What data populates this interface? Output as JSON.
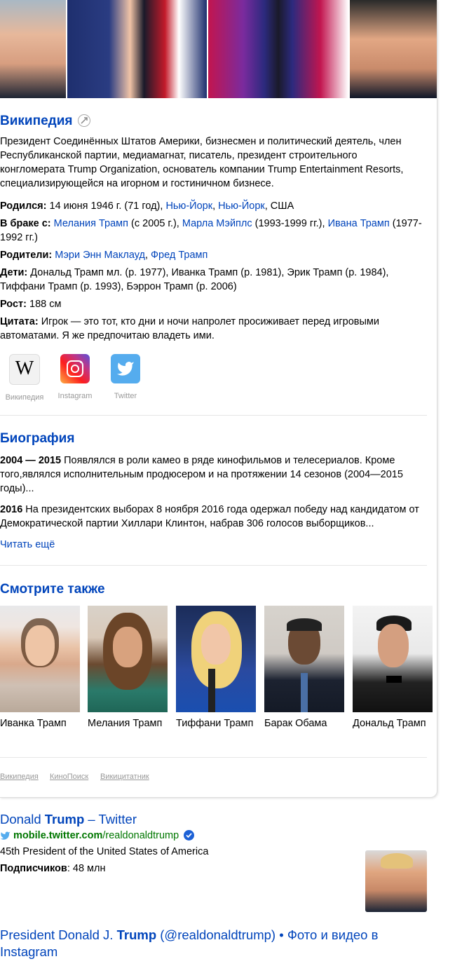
{
  "wiki": {
    "title": "Википедия",
    "description": "Президент Соединённых Штатов Америки, бизнесмен и политический деятель, член Республиканской партии, медиамагнат, писатель, президент строительного конгломерата Trump Organization, основатель компании Trump Entertainment Resorts, специализирующейся на игорном и гостиничном бизнесе.",
    "born": {
      "label": "Родился:",
      "value": "14 июня 1946 г. (71 год),",
      "link1": "Нью-Йорк",
      "sep": ",",
      "link2": "Нью-Йорк",
      "rest": ", США"
    },
    "married": {
      "label": "В браке с:",
      "link1": "Мелания Трамп",
      "t1": "(с 2005 г.),",
      "link2": "Марла Мэйплс",
      "t2": "(1993-1999 гг.),",
      "link3": "Ивана Трамп",
      "t3": "(1977-1992 гг.)"
    },
    "parents": {
      "label": "Родители:",
      "link1": "Мэри Энн Маклауд",
      "sep": ",",
      "link2": "Фред Трамп"
    },
    "children": {
      "label": "Дети:",
      "value": "Дональд Трамп мл. (р. 1977), Иванка Трамп (р. 1981), Эрик Трамп (р. 1984), Тиффани Трамп (р. 1993), Бэррон Трамп (р. 2006)"
    },
    "height": {
      "label": "Рост:",
      "value": "188 см"
    },
    "quote": {
      "label": "Цитата:",
      "value": "Игрок — это тот, кто дни и ночи напролет просиживает перед игровыми автоматами. Я же предпочитаю владеть ими."
    }
  },
  "socials": [
    {
      "label": "Википедия",
      "icon": "wikipedia-icon"
    },
    {
      "label": "Instagram",
      "icon": "instagram-icon"
    },
    {
      "label": "Twitter",
      "icon": "twitter-icon"
    }
  ],
  "bio": {
    "title": "Биография",
    "items": [
      {
        "year": "2004 — 2015",
        "text": "Появлялся в роли камео в ряде кинофильмов и телесериалов. Кроме того,являлся исполнительным продюсером и на протяжении 14 сезонов (2004—2015 годы)..."
      },
      {
        "year": "2016",
        "text": "На президентских выборах 8 ноября 2016 года одержал победу над кандидатом от Демократической партии Хиллари Клинтон, набрав 306 голосов выборщиков..."
      }
    ],
    "read_more": "Читать ещё"
  },
  "see_also": {
    "title": "Смотрите также",
    "people": [
      "Иванка Трамп",
      "Мелания Трамп",
      "Тиффани Трамп",
      "Барак Обама",
      "Дональд Трамп"
    ]
  },
  "sources": [
    "Википедия",
    "КиноПоиск",
    "Викицитатник"
  ],
  "results": [
    {
      "title_pre": "Donald ",
      "title_bold": "Trump",
      "title_post": " – Twitter",
      "url_bold": "mobile.twitter.com",
      "url_rest": "/realdonaldtrump",
      "desc": "45th President of the United States of America",
      "followers_label": "Подписчиков",
      "followers_value": ": 48 млн"
    },
    {
      "title_pre": "President Donald J. ",
      "title_bold": "Trump",
      "title_post": " (@realdonaldtrump) • Фото и видео в Instagram"
    }
  ],
  "colors": {
    "link": "#0044bb",
    "url": "#007700",
    "muted": "#999999"
  }
}
